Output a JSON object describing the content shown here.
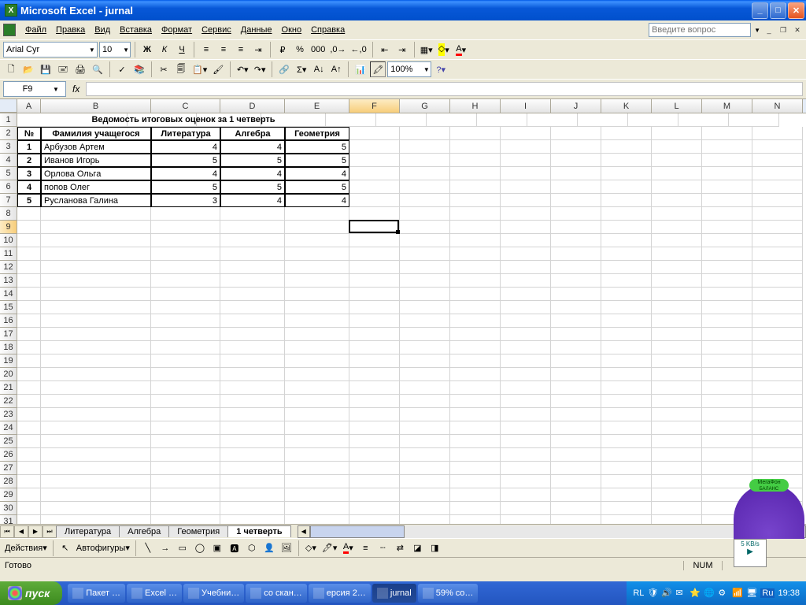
{
  "window": {
    "title": "Microsoft Excel - jurnal"
  },
  "menus": [
    "Файл",
    "Правка",
    "Вид",
    "Вставка",
    "Формат",
    "Сервис",
    "Данные",
    "Окно",
    "Справка"
  ],
  "askbox_placeholder": "Введите вопрос",
  "format_toolbar": {
    "font": "Arial Cyr",
    "size": "10",
    "zoom": "100%"
  },
  "namebox": {
    "cell": "F9",
    "fx": "fx"
  },
  "columns": [
    "A",
    "B",
    "C",
    "D",
    "E",
    "F",
    "G",
    "H",
    "I",
    "J",
    "K",
    "L",
    "M",
    "N"
  ],
  "table": {
    "title": "Ведомость итоговых оценок за 1 четверть",
    "headers": {
      "num": "№",
      "name": "Фамилия учащегося",
      "c1": "Литература",
      "c2": "Алгебра",
      "c3": "Геометрия"
    },
    "rows": [
      {
        "n": "1",
        "name": "Арбузов Артем",
        "v": [
          "4",
          "4",
          "5"
        ]
      },
      {
        "n": "2",
        "name": "Иванов Игорь",
        "v": [
          "5",
          "5",
          "5"
        ]
      },
      {
        "n": "3",
        "name": "Орлова Ольга",
        "v": [
          "4",
          "4",
          "4"
        ]
      },
      {
        "n": "4",
        "name": "попов Олег",
        "v": [
          "5",
          "5",
          "5"
        ]
      },
      {
        "n": "5",
        "name": "Русланова Галина",
        "v": [
          "3",
          "4",
          "4"
        ]
      }
    ]
  },
  "sheet_tabs": [
    "Литература",
    "Алгебра",
    "Геометрия",
    "1 четверть"
  ],
  "active_tab": 3,
  "draw_toolbar": {
    "actions": "Действия",
    "autoshapes": "Автофигуры"
  },
  "statusbar": {
    "ready": "Готово",
    "num": "NUM"
  },
  "taskbar": {
    "start": "пуск",
    "buttons": [
      "Пакет …",
      "Excel …",
      "Учебни…",
      "со скан…",
      "ерсия 2…",
      "jurnal",
      "59% co…"
    ],
    "active_button": 5,
    "lang1": "RL",
    "lang2": "Ru",
    "clock": "19:38"
  },
  "widget": {
    "brand": "МегаФон",
    "sub": "БАЛАНС",
    "net": "5 KB/s"
  },
  "active_cell": {
    "col": "F",
    "row": 9
  }
}
